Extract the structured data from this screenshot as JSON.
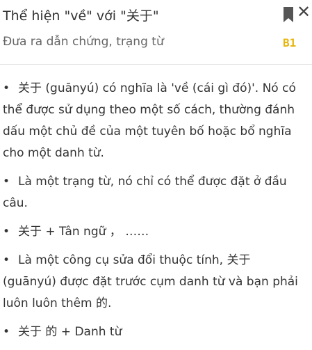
{
  "header": {
    "title": "Thể hiện \"về\" với \"关于\"",
    "subtitle": "Đưa ra dẫn chứng, trạng từ",
    "level": "B1",
    "bookmark_icon": "bookmark-icon",
    "close_icon": "close-icon"
  },
  "content": {
    "bullet": "•",
    "items": [
      "关于 (guānyú) có nghĩa là 'về (cái gì đó)'. Nó có thể được sử dụng theo một số cách, thường đánh dấu một chủ đề của một tuyên bố hoặc bổ nghĩa cho một danh từ.",
      "Là một trạng từ, nó chỉ có thể được đặt ở đầu câu.",
      "关于 + Tân ngữ ， ……",
      "Là một công cụ sửa đổi thuộc tính, 关于 (guānyú) được đặt trước cụm danh từ và bạn phải luôn luôn thêm 的.",
      "关于 的 + Danh từ"
    ]
  },
  "colors": {
    "level": "#e8b50c",
    "text": "#333333",
    "subtitle": "#666666"
  }
}
